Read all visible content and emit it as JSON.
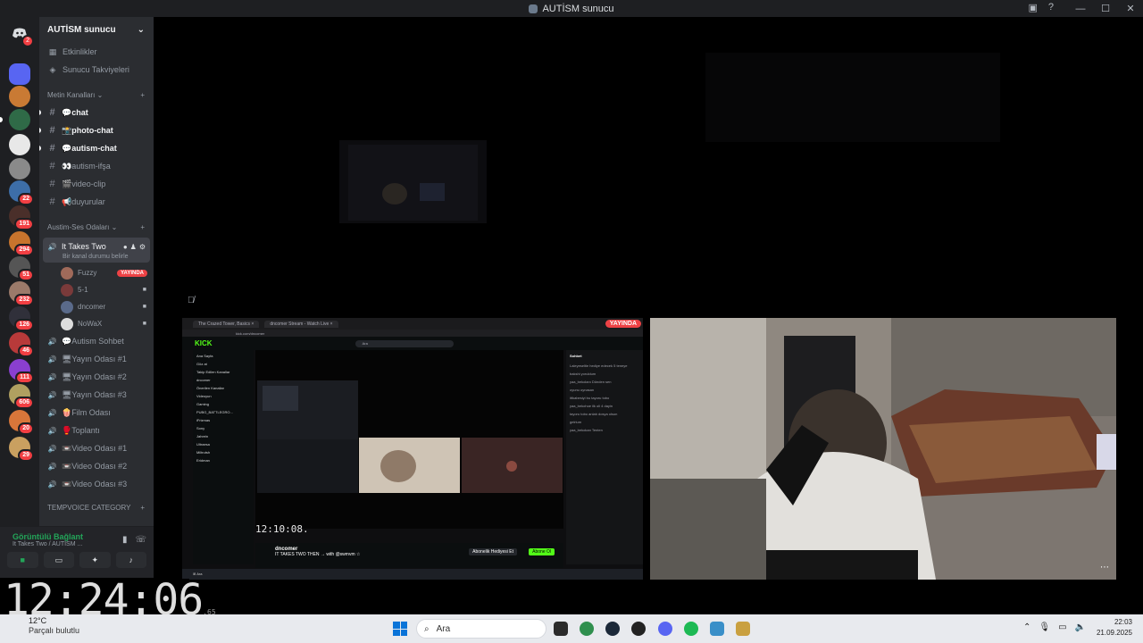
{
  "window": {
    "title": "AUTİSM sunucu",
    "controls": [
      "—",
      "☐",
      "✕"
    ]
  },
  "guilds": {
    "home_badge": "2",
    "items": [
      {
        "color": "#5865f2",
        "badge": ""
      },
      {
        "color": "#c97a34",
        "badge": ""
      },
      {
        "color": "#2f6a47",
        "badge": ""
      },
      {
        "color": "#e8e8e8",
        "badge": ""
      },
      {
        "color": "#8a8a8a",
        "badge": ""
      },
      {
        "color": "#3d6ea8",
        "badge": "22"
      },
      {
        "color": "#4a2f2a",
        "badge": "191"
      },
      {
        "color": "#c8742d",
        "badge": "294"
      },
      {
        "color": "#555555",
        "badge": "51"
      },
      {
        "color": "#9b7a6a",
        "badge": "232"
      },
      {
        "color": "#30303a",
        "badge": "126"
      },
      {
        "color": "#b83a3a",
        "badge": "46"
      },
      {
        "color": "#8a3fd0",
        "badge": "111"
      },
      {
        "color": "#b0a060",
        "badge": "606"
      },
      {
        "color": "#d8763a",
        "badge": "20"
      },
      {
        "color": "#c9a060",
        "badge": "29"
      }
    ]
  },
  "sidebar": {
    "server_name": "AUTİSM sunucu",
    "events": "Etkinlikler",
    "boosts": "Sunucu Takviyeleri",
    "text_category": "Metin Kanalları",
    "text_channels": [
      {
        "name": "💬chat",
        "unread": true
      },
      {
        "name": "📸photo-chat",
        "unread": true
      },
      {
        "name": "💬autism-chat",
        "unread": true
      },
      {
        "name": "👀autism-ifşa",
        "unread": false
      },
      {
        "name": "🎬video-clip",
        "unread": false
      },
      {
        "name": "📢duyurular",
        "unread": false
      }
    ],
    "voice_category": "Austim-Ses Odaları",
    "active_voice": {
      "name": "It Takes Two",
      "status": "Bir kanal durumu belirle"
    },
    "members": [
      {
        "name": "Fuzzy",
        "live": "YAYINDA",
        "color": "#a06a5a"
      },
      {
        "name": "5-1",
        "live": "",
        "color": "#7a3a3a"
      },
      {
        "name": "dncomer",
        "live": "",
        "color": "#5a6a8a"
      },
      {
        "name": "NoWaX",
        "live": "",
        "color": "#dddddd"
      }
    ],
    "voice_channels": [
      "💬Autism Sohbet",
      "🖥Yayın Odası #1",
      "🖥Yayın Odası #2",
      "🖥Yayın Odası #3",
      "🍿Film Odası",
      "🥊Toplantı",
      "📼Video Odası #1",
      "📼Video Odası #2",
      "📼Video Odası #3"
    ],
    "temp_category": "TEMPVOICE CATEGORY"
  },
  "voice_panel": {
    "title": "Görüntülü Bağlant",
    "subtitle": "It Takes Two / AUTİSM ..."
  },
  "stream": {
    "live_label": "YAYINDA",
    "tabs": [
      "The Crazed Tower, Basics ×",
      "dncomer Stream - Watch Live ×"
    ],
    "url": "kick.com/dncomer",
    "logo": "KICK",
    "search": "Ara",
    "left_nav": [
      "Ana Sayfa",
      "Göz at",
      "Takip Edilen Kanallar",
      "dncomer",
      "Önerilen Kanallar",
      "Videoyun",
      "Gaming",
      "PUBG_BATTLEGRO...",
      "iFrizmas",
      "Sony",
      "Jahrein",
      "Ultraesa",
      "Miltrutsh",
      "Eridman"
    ],
    "clock": "12:10:08.",
    "streamer": "dncomer",
    "stream_title": "IT TAKES TWO THEN → with @swmvm ☆",
    "chat_title": "Sohbet",
    "chat_lines": [
      "Laleyeseltie hediye edecek 5 teneye",
      "bakshi yoruldum",
      "yaa_bekolanı Dünden sen",
      "oyunu oynasan",
      "ittkabesiyi bu tayoru tobo",
      "yaa_bekohoe ilk oli 4 dayin",
      "tayoru tobo anlatı dosya olsun",
      "gelrium",
      "yaa_bekokan Tenten"
    ],
    "follow_btn": "Abone Ol",
    "gift_btn": "Abonelik Hediyesi Et"
  },
  "overlay_clock": {
    "time": "12:24:06",
    "fraction": ".65"
  },
  "taskbar": {
    "temp": "12°C",
    "weather": "Parçalı bulutlu",
    "search_placeholder": "Ara",
    "time": "22:03",
    "date": "21.09.2025"
  }
}
